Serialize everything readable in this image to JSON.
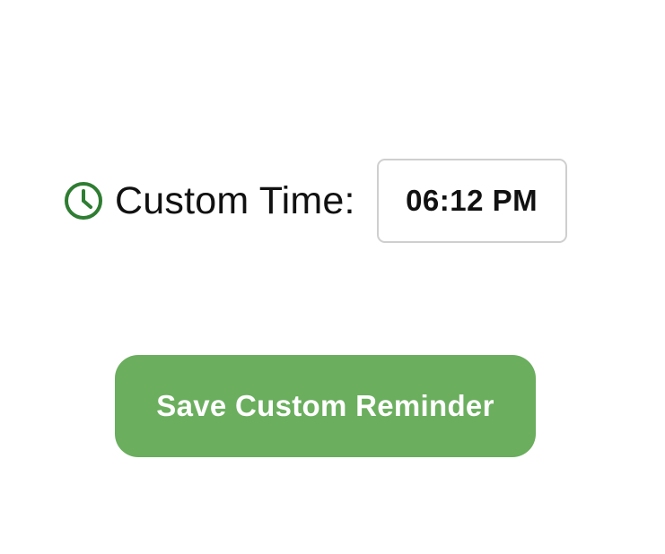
{
  "custom_time": {
    "icon": "clock-icon",
    "icon_color": "#2e7d32",
    "label": "Custom Time:",
    "value": "06:12 PM"
  },
  "actions": {
    "save_label": "Save Custom Reminder",
    "save_color": "#6aae5e"
  }
}
